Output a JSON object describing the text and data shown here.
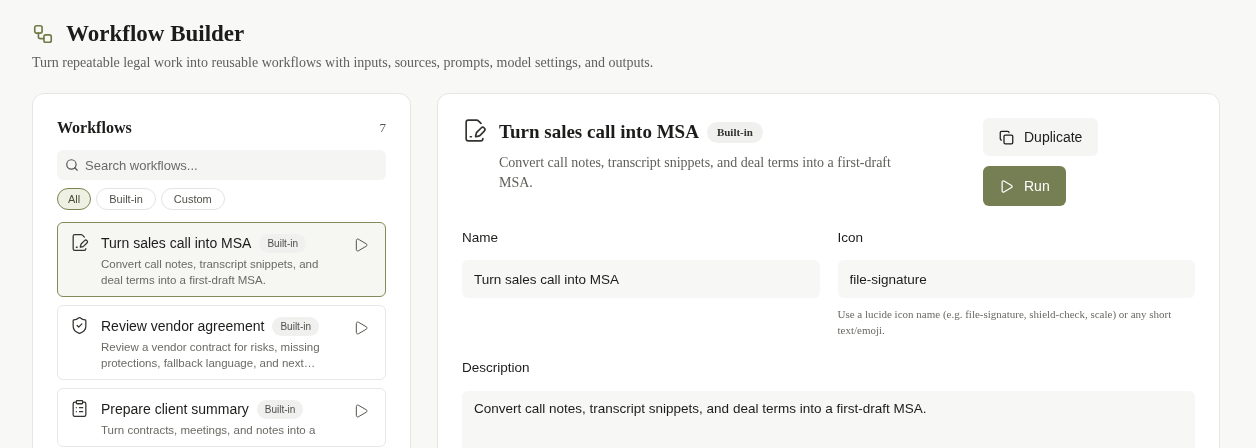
{
  "page": {
    "title": "Workflow Builder",
    "subtitle": "Turn repeatable legal work into reusable workflows with inputs, sources, prompts, model settings, and outputs."
  },
  "sidebar": {
    "title": "Workflows",
    "count": "7",
    "search": {
      "placeholder": "Search workflows..."
    },
    "filters": [
      {
        "label": "All",
        "selected": true
      },
      {
        "label": "Built-in",
        "selected": false
      },
      {
        "label": "Custom",
        "selected": false
      }
    ],
    "items": [
      {
        "kind": "file-signature",
        "title": "Turn sales call into MSA",
        "badge": "Built-in",
        "description": "Convert call notes, transcript snippets, and deal terms into a first-draft MSA.",
        "selected": true
      },
      {
        "kind": "shield-check",
        "title": "Review vendor agreement",
        "badge": "Built-in",
        "description": "Review a vendor contract for risks, missing protections, fallback language, and next…",
        "selected": false
      },
      {
        "kind": "clipboard-list",
        "title": "Prepare client summary",
        "badge": "Built-in",
        "description": "Turn contracts, meetings, and notes into a",
        "selected": false
      }
    ]
  },
  "detail": {
    "kind": "file-signature",
    "title": "Turn sales call into MSA",
    "badge": "Built-in",
    "description": "Convert call notes, transcript snippets, and deal terms into a first-draft MSA.",
    "buttons": {
      "duplicate": "Duplicate",
      "run": "Run"
    },
    "form": {
      "name": {
        "label": "Name",
        "value": "Turn sales call into MSA"
      },
      "icon": {
        "label": "Icon",
        "value": "file-signature",
        "hint": "Use a lucide icon name (e.g. file-signature, shield-check, scale) or any short text/emoji."
      },
      "description": {
        "label": "Description",
        "value": "Convert call notes, transcript snippets, and deal terms into a first-draft MSA."
      }
    }
  }
}
